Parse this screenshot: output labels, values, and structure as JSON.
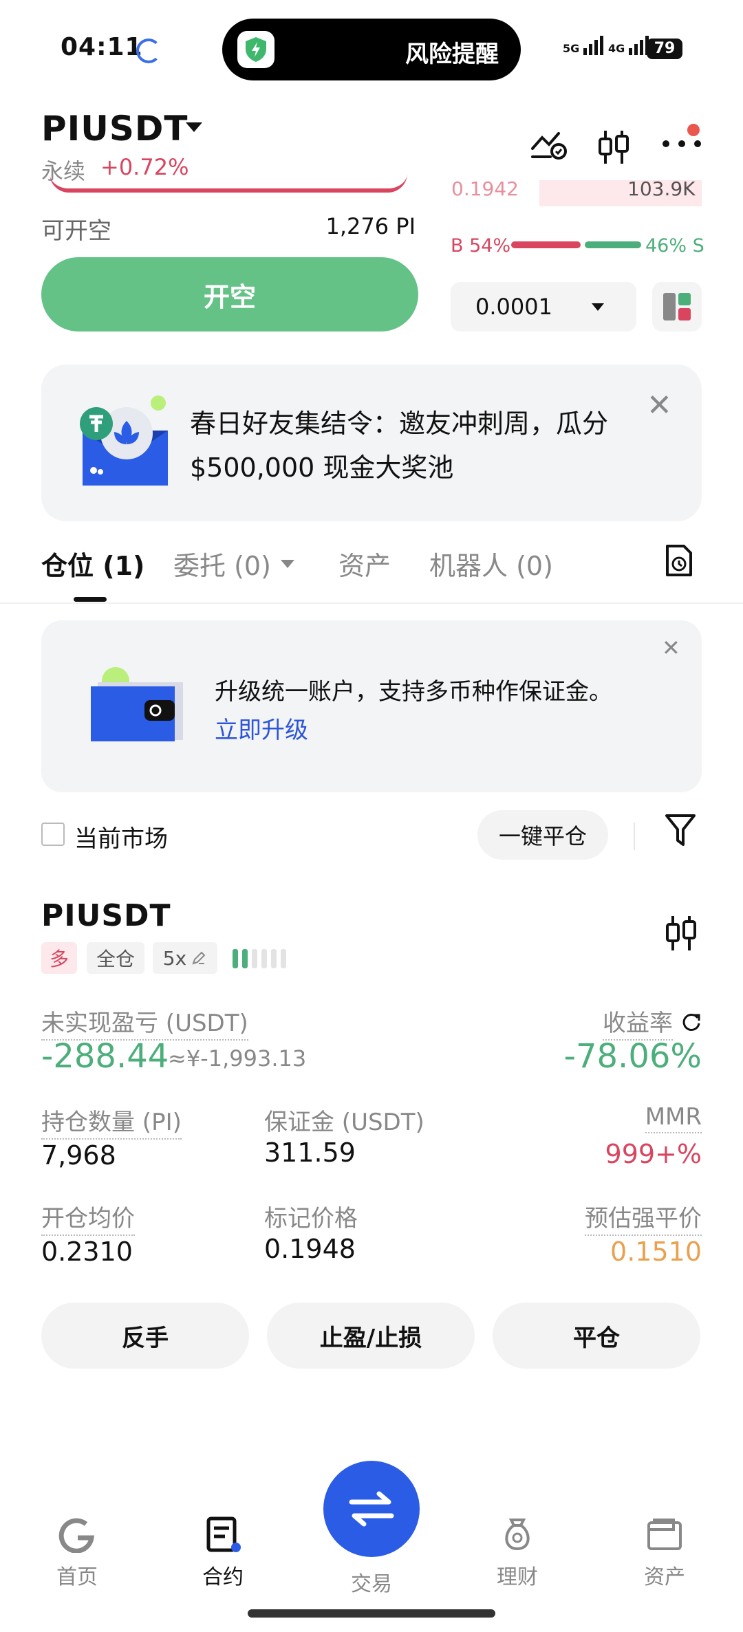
{
  "status_bar": {
    "time": "04:11",
    "island_text": "风险提醒",
    "signal_1": "5G",
    "signal_2": "4G",
    "battery": "79"
  },
  "header": {
    "pair": "PIUSDT",
    "type_label": "永续",
    "change": "+0.72%"
  },
  "order_panel": {
    "orderbook_price": "0.1942",
    "orderbook_qty": "103.9K",
    "available_label": "可开空",
    "available_value": "1,276 PI",
    "buy_ratio": "B 54%",
    "sell_ratio": "46% S",
    "open_short_label": "开空",
    "precision": "0.0001"
  },
  "banner": {
    "text": "春日好友集结令：邀友冲刺周，瓜分 $500,000 现金大奖池"
  },
  "tabs": {
    "positions": "仓位 (1)",
    "orders": "委托 (0)",
    "assets": "资产",
    "bots": "机器人 (0)"
  },
  "upgrade_card": {
    "text": "升级统一账户，支持多币种作保证金。",
    "link": "立即升级"
  },
  "filter": {
    "current_market": "当前市场",
    "close_all": "一键平仓"
  },
  "position": {
    "symbol": "PIUSDT",
    "side_tag": "多",
    "margin_mode": "全仓",
    "leverage": "5x",
    "pnl_label": "未实现盈亏 (USDT)",
    "pnl_value": "-288.44",
    "pnl_cny": "≈¥-1,993.13",
    "roe_label": "收益率",
    "roe_value": "-78.06%",
    "size_label": "持仓数量 (PI)",
    "size_value": "7,968",
    "margin_label": "保证金 (USDT)",
    "margin_value": "311.59",
    "mmr_label": "MMR",
    "mmr_value": "999+%",
    "entry_label": "开仓均价",
    "entry_value": "0.2310",
    "mark_label": "标记价格",
    "mark_value": "0.1948",
    "liq_label": "预估强平价",
    "liq_value": "0.1510",
    "btn_reverse": "反手",
    "btn_tpsl": "止盈/止损",
    "btn_close": "平仓"
  },
  "bottom_nav": {
    "home": "首页",
    "contract": "合约",
    "trade": "交易",
    "finance": "理财",
    "assets": "资产"
  },
  "colors": {
    "red": "#d9455f",
    "green": "#4cae7a",
    "button_green": "#64c287",
    "orange": "#e9a04f",
    "blue": "#2a5ce6"
  }
}
